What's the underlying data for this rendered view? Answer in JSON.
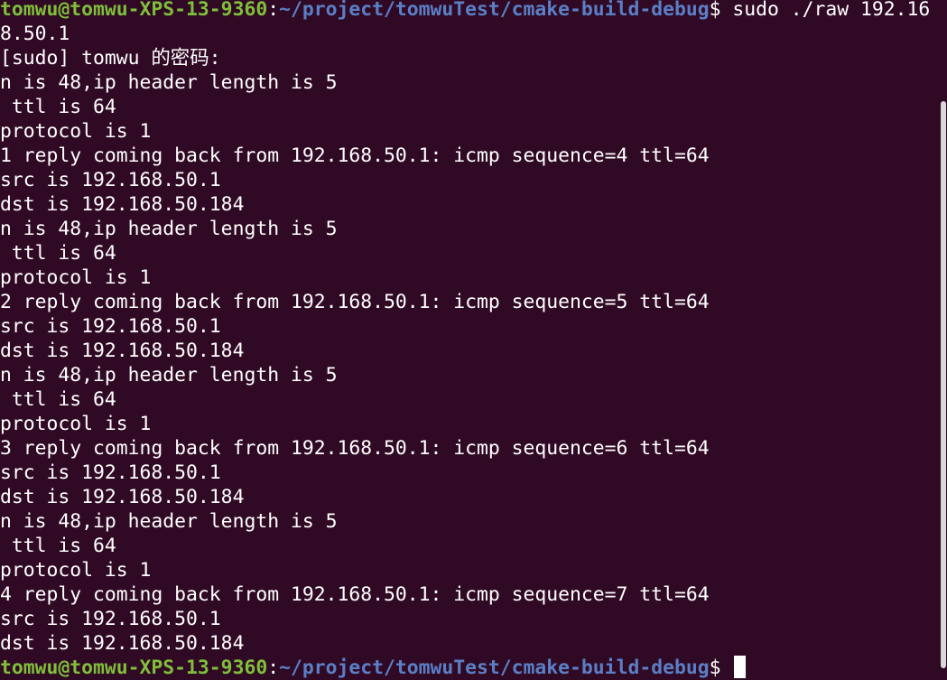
{
  "colors": {
    "background": "#300a24",
    "prompt_user": "#7fbf3a",
    "prompt_path": "#5b7fc7",
    "text": "#ffffff"
  },
  "terminal": {
    "prompt": {
      "user_host": "tomwu@tomwu-XPS-13-9360",
      "separator": ":",
      "path": "~/project/tomwuTest/cmake-build-debug",
      "dollar": "$"
    },
    "command_line_1": " sudo ./raw 192.16",
    "command_line_2": "8.50.1",
    "lines": [
      "[sudo] tomwu 的密码:",
      "n is 48,ip header length is 5",
      " ttl is 64",
      "protocol is 1",
      "1 reply coming back from 192.168.50.1: icmp sequence=4 ttl=64",
      "src is 192.168.50.1",
      "dst is 192.168.50.184",
      "n is 48,ip header length is 5",
      " ttl is 64",
      "protocol is 1",
      "2 reply coming back from 192.168.50.1: icmp sequence=5 ttl=64",
      "src is 192.168.50.1",
      "dst is 192.168.50.184",
      "n is 48,ip header length is 5",
      " ttl is 64",
      "protocol is 1",
      "3 reply coming back from 192.168.50.1: icmp sequence=6 ttl=64",
      "src is 192.168.50.1",
      "dst is 192.168.50.184",
      "n is 48,ip header length is 5",
      " ttl is 64",
      "protocol is 1",
      "4 reply coming back from 192.168.50.1: icmp sequence=7 ttl=64",
      "src is 192.168.50.1",
      "dst is 192.168.50.184"
    ],
    "final_prompt_dollar": "$ "
  }
}
